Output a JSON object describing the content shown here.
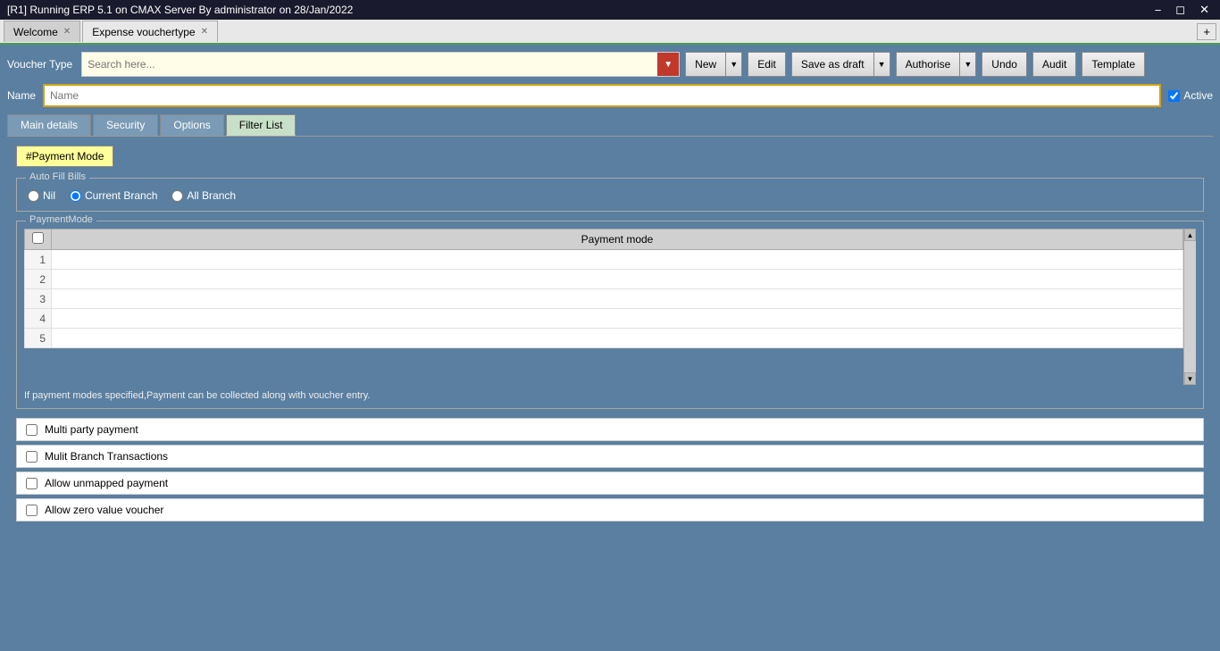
{
  "titleBar": {
    "title": "[R1] Running ERP 5.1 on CMAX Server By administrator on 28/Jan/2022",
    "controls": [
      "minimize",
      "restore",
      "close"
    ]
  },
  "tabs": [
    {
      "label": "Welcome",
      "active": false,
      "closable": true
    },
    {
      "label": "Expense vouchertype",
      "active": true,
      "closable": true
    }
  ],
  "tabAdd": "+",
  "toolbar": {
    "voucherTypeLabel": "Voucher Type",
    "searchPlaceholder": "Search here...",
    "buttons": {
      "new": "New",
      "edit": "Edit",
      "saveAsDraft": "Save as draft",
      "authorise": "Authorise",
      "undo": "Undo",
      "audit": "Audit",
      "template": "Template"
    }
  },
  "nameRow": {
    "label": "Name",
    "placeholder": "Name",
    "activeLabel": "Active",
    "activeChecked": true
  },
  "formTabs": [
    {
      "label": "Main details",
      "active": false
    },
    {
      "label": "Security",
      "active": false
    },
    {
      "label": "Options",
      "active": false
    },
    {
      "label": "Filter List",
      "active": true
    }
  ],
  "filterList": {
    "paymentModeBtn": "#Payment Mode",
    "autoFillBills": {
      "legend": "Auto Fill Bills",
      "options": [
        {
          "label": "Nil",
          "value": "nil",
          "checked": false
        },
        {
          "label": "Current Branch",
          "value": "current",
          "checked": true
        },
        {
          "label": "All Branch",
          "value": "all",
          "checked": false
        }
      ]
    },
    "paymentMode": {
      "legend": "PaymentMode",
      "columnHeader": "Payment mode",
      "rows": [
        1,
        2,
        3,
        4,
        5
      ],
      "infoText": "If payment modes specified,Payment can be collected along with voucher entry."
    },
    "checkboxItems": [
      {
        "label": "Multi party payment",
        "checked": false
      },
      {
        "label": "Mulit Branch Transactions",
        "checked": false
      },
      {
        "label": "Allow unmapped payment",
        "checked": false
      },
      {
        "label": "Allow zero value voucher",
        "checked": false
      }
    ]
  }
}
